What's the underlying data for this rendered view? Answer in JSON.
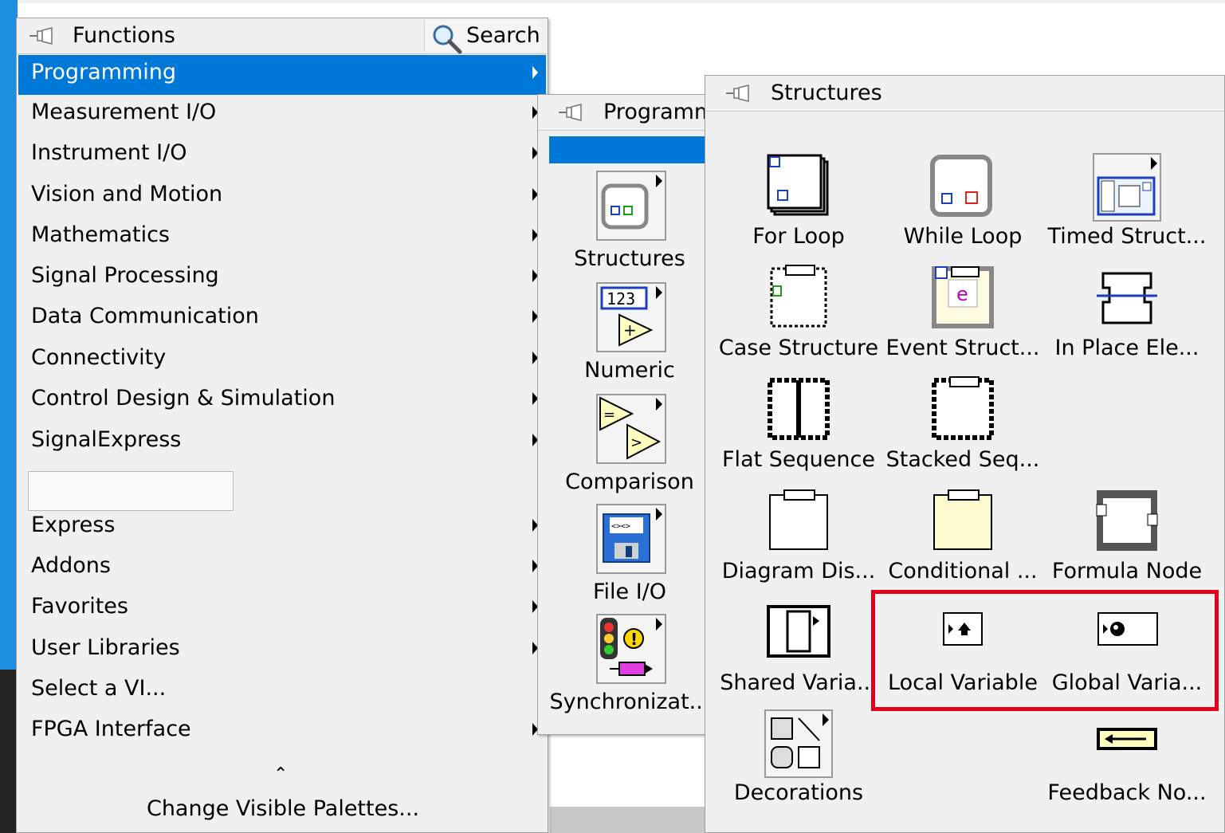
{
  "functions_palette": {
    "title": "Functions",
    "search_label": "Search",
    "categories": [
      {
        "label": "Programming",
        "selected": true
      },
      {
        "label": "Measurement I/O"
      },
      {
        "label": "Instrument I/O"
      },
      {
        "label": "Vision and Motion"
      },
      {
        "label": "Mathematics"
      },
      {
        "label": "Signal Processing"
      },
      {
        "label": "Data Communication"
      },
      {
        "label": "Connectivity"
      },
      {
        "label": "Control Design & Simulation"
      },
      {
        "label": "SignalExpress"
      }
    ],
    "more_categories": [
      {
        "label": "Express"
      },
      {
        "label": "Addons"
      },
      {
        "label": "Favorites"
      },
      {
        "label": "User Libraries"
      },
      {
        "label": "Select a VI..."
      },
      {
        "label": "FPGA Interface"
      }
    ],
    "change_visible_palettes": "Change Visible Palettes..."
  },
  "programming_palette": {
    "title": "Programm",
    "items": [
      {
        "label": "Structures",
        "icon": "structures-icon"
      },
      {
        "label": "Numeric",
        "icon": "numeric-icon"
      },
      {
        "label": "Comparison",
        "icon": "comparison-icon"
      },
      {
        "label": "File I/O",
        "icon": "file-io-icon"
      },
      {
        "label": "Synchronizat...",
        "icon": "synchronization-icon"
      }
    ]
  },
  "structures_palette": {
    "title": "Structures",
    "items": [
      {
        "label": "For Loop",
        "icon": "for-loop-icon"
      },
      {
        "label": "While Loop",
        "icon": "while-loop-icon"
      },
      {
        "label": "Timed Struct...",
        "icon": "timed-structure-icon"
      },
      {
        "label": "Case Structure",
        "icon": "case-structure-icon"
      },
      {
        "label": "Event Struct...",
        "icon": "event-structure-icon"
      },
      {
        "label": "In Place Ele...",
        "icon": "in-place-element-icon"
      },
      {
        "label": "Flat Sequence",
        "icon": "flat-sequence-icon"
      },
      {
        "label": "Stacked Seq...",
        "icon": "stacked-sequence-icon"
      },
      {
        "label": "Diagram Dis...",
        "icon": "diagram-disable-icon"
      },
      {
        "label": "Conditional ...",
        "icon": "conditional-disable-icon"
      },
      {
        "label": "Formula Node",
        "icon": "formula-node-icon"
      },
      {
        "label": "Shared Varia...",
        "icon": "shared-variable-icon"
      },
      {
        "label": "Local Variable",
        "icon": "local-variable-icon"
      },
      {
        "label": "Global Varia...",
        "icon": "global-variable-icon"
      },
      {
        "label": "Decorations",
        "icon": "decorations-icon"
      },
      {
        "label": "Feedback No...",
        "icon": "feedback-node-icon"
      }
    ]
  },
  "colors": {
    "selection": "#0078d7",
    "highlight": "#e0001b"
  }
}
